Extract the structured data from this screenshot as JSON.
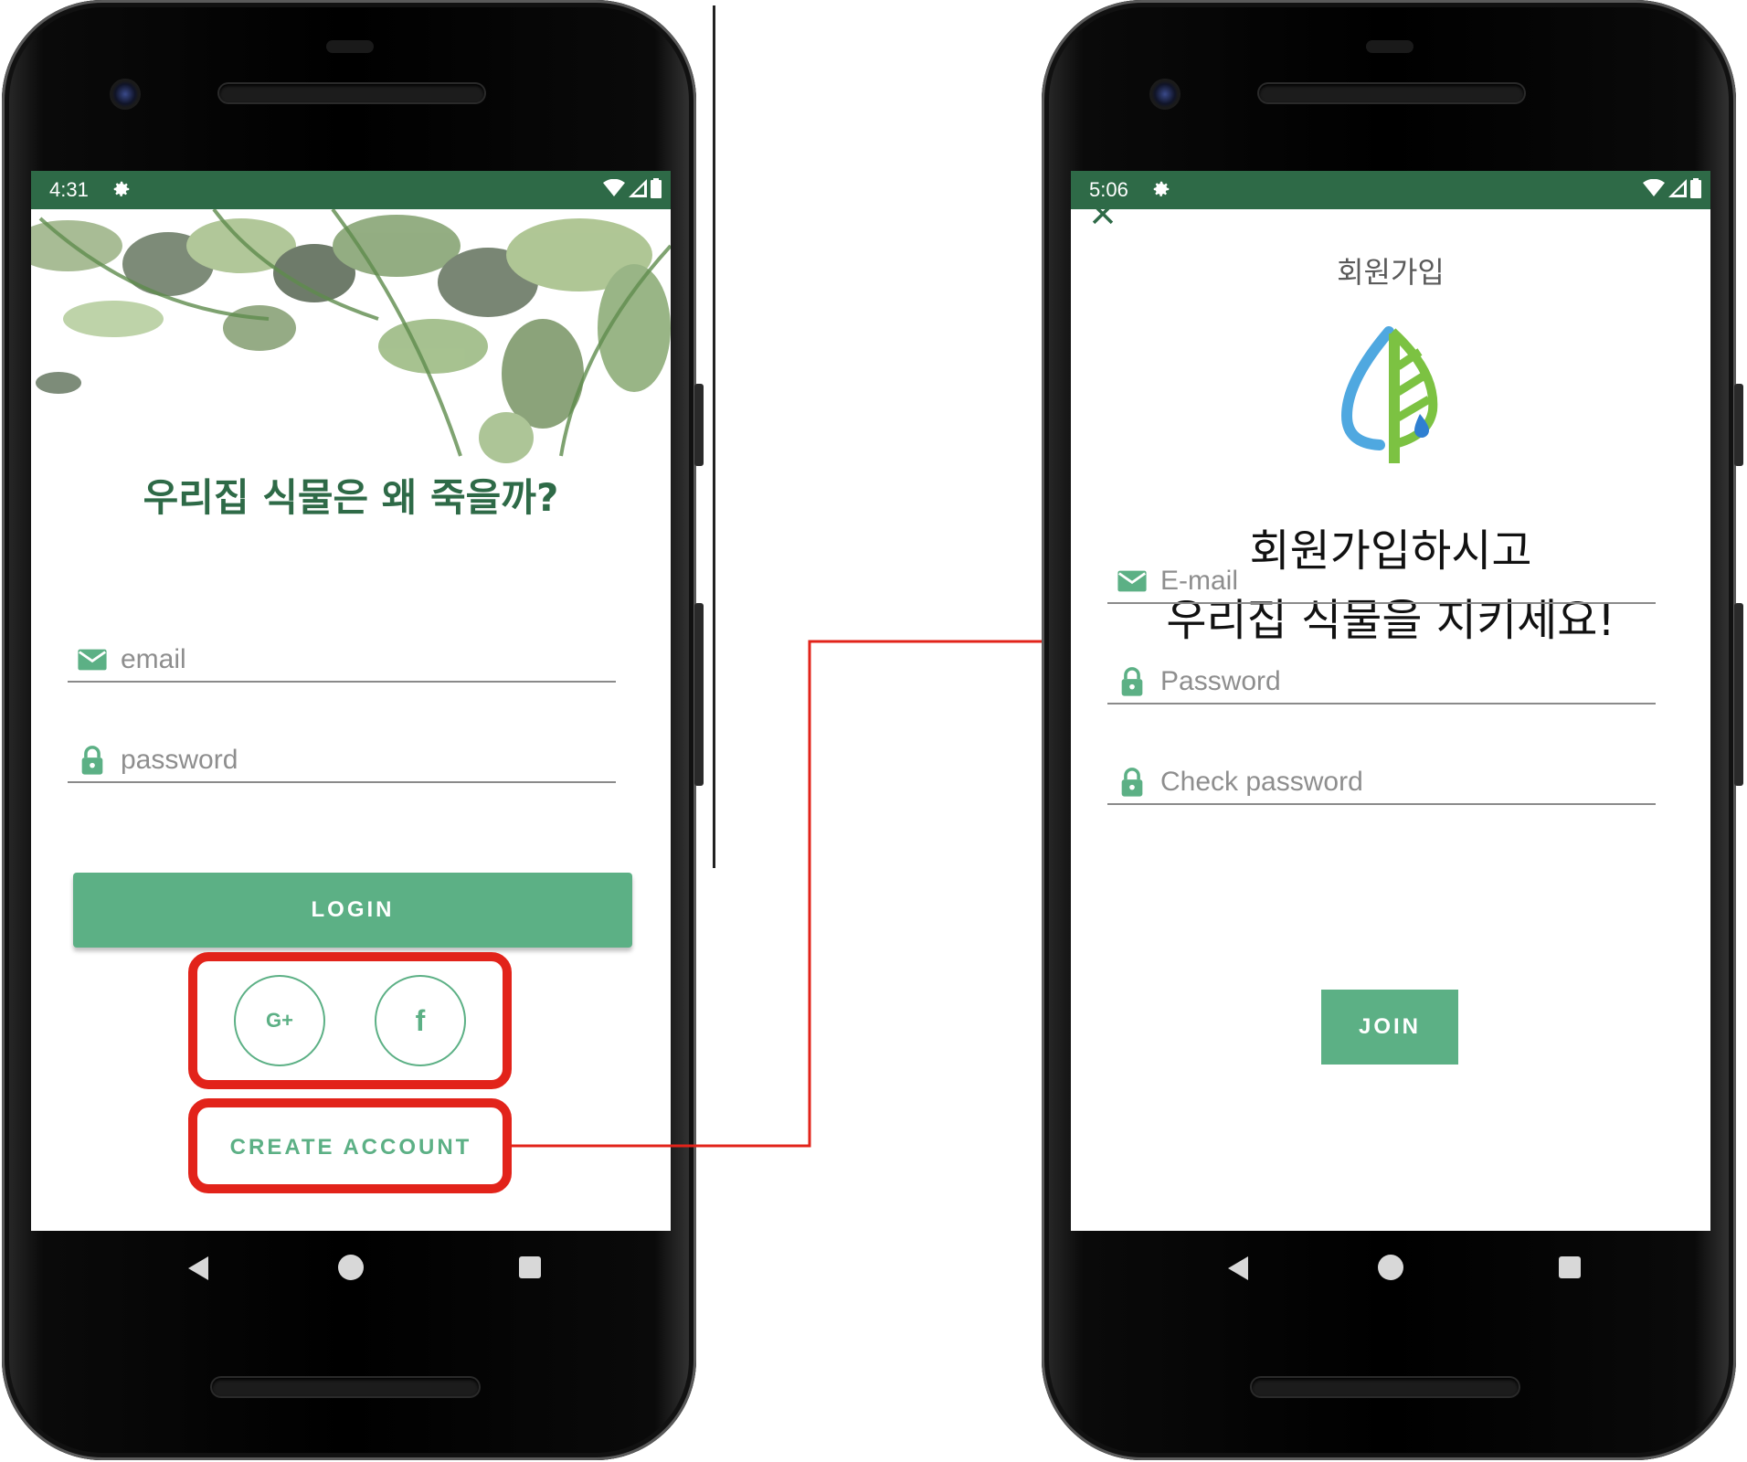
{
  "login_screen": {
    "status": {
      "time": "4:31"
    },
    "tagline": "우리집 식물은 왜 죽을까?",
    "email_placeholder": "email",
    "password_placeholder": "password",
    "login_label": "LOGIN",
    "google_label": "G+",
    "facebook_label": "f",
    "create_account_label": "CREATE ACCOUNT"
  },
  "signup_screen": {
    "status": {
      "time": "5:06"
    },
    "title": "회원가입",
    "headline_line1": "회원가입하시고",
    "headline_line2": "우리집 식물을 지키세요!",
    "email_placeholder": "E-mail",
    "password_placeholder": "Password",
    "check_password_placeholder": "Check password",
    "join_label": "JOIN"
  },
  "colors": {
    "status_bar": "#2e6a47",
    "accent": "#5cb085",
    "highlight": "#e2231a",
    "connector": "#e2231a"
  },
  "icons": [
    "gear-icon",
    "wifi-icon",
    "signal-icon",
    "battery-icon",
    "mail-icon",
    "lock-icon",
    "close-icon",
    "leaf-drop-logo",
    "back-icon",
    "home-icon",
    "recents-icon"
  ]
}
